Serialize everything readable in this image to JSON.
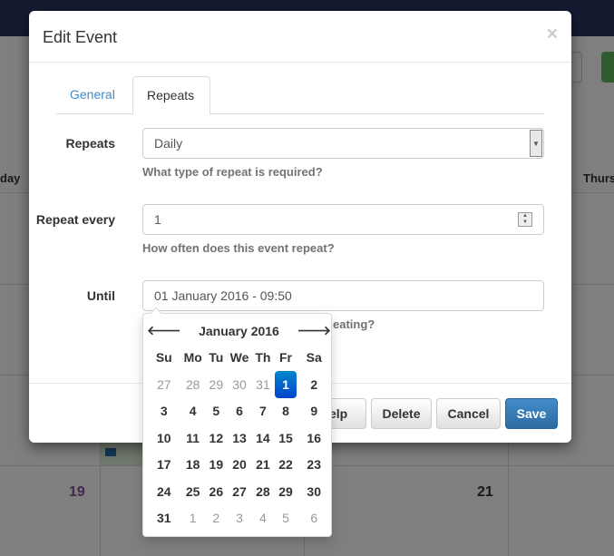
{
  "background": {
    "day_header_left": "day",
    "day_header_right": "Thurs",
    "date_19": "19",
    "date_21": "21"
  },
  "modal": {
    "title": "Edit Event",
    "close": "×",
    "tabs": [
      {
        "label": "General"
      },
      {
        "label": "Repeats",
        "active": true
      }
    ],
    "repeats": {
      "label": "Repeats",
      "value": "Daily",
      "help": "What type of repeat is required?"
    },
    "repeat_every": {
      "label": "Repeat every",
      "value": "1",
      "help": "How often does this event repeat?"
    },
    "until": {
      "label": "Until",
      "value": "01 January 2016 - 09:50",
      "help_visible": "eating?"
    },
    "buttons": {
      "help": "Help",
      "delete": "Delete",
      "cancel": "Cancel",
      "save": "Save"
    }
  },
  "datepicker": {
    "month": "January 2016",
    "prev": "🡐",
    "next": "🡒",
    "weekdays": [
      "Su",
      "Mo",
      "Tu",
      "We",
      "Th",
      "Fr",
      "Sa"
    ],
    "weeks": [
      [
        "27",
        "28",
        "29",
        "30",
        "31",
        "1",
        "2"
      ],
      [
        "3",
        "4",
        "5",
        "6",
        "7",
        "8",
        "9"
      ],
      [
        "10",
        "11",
        "12",
        "13",
        "14",
        "15",
        "16"
      ],
      [
        "17",
        "18",
        "19",
        "20",
        "21",
        "22",
        "23"
      ],
      [
        "24",
        "25",
        "26",
        "27",
        "28",
        "29",
        "30"
      ],
      [
        "31",
        "1",
        "2",
        "3",
        "4",
        "5",
        "6"
      ]
    ],
    "selected": "1"
  },
  "colors": {
    "primary": "#428bca",
    "selected_day": "#0055cc",
    "topbar": "#141b31"
  }
}
